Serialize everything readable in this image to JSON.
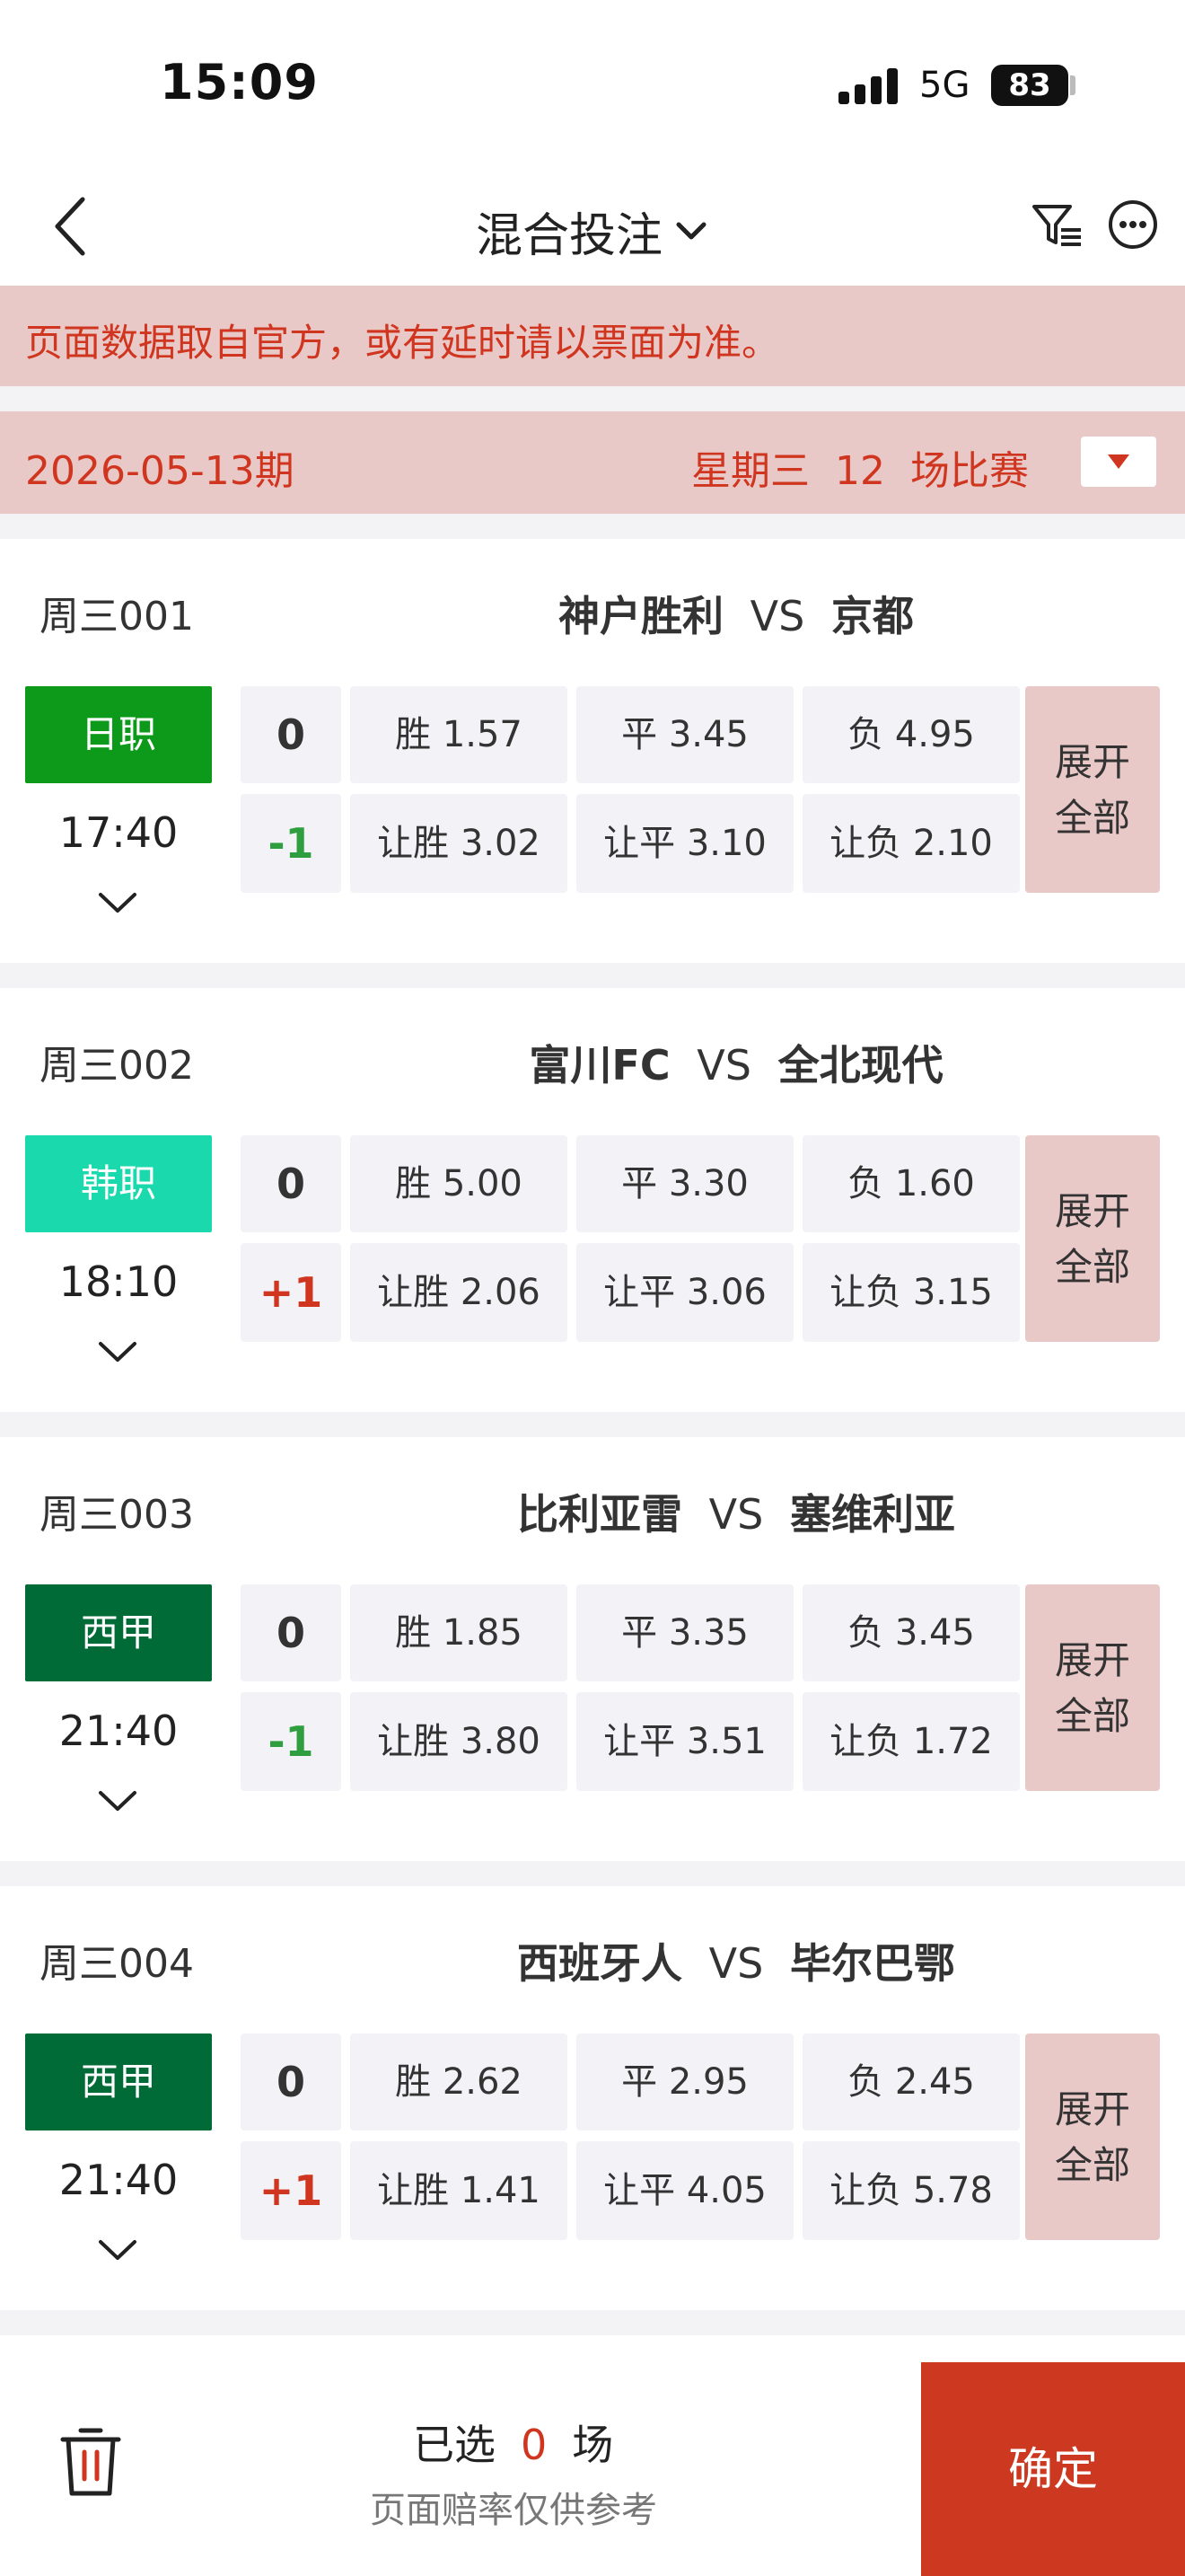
{
  "status_bar": {
    "time": "15:09",
    "network": "5G",
    "battery": "83"
  },
  "nav": {
    "title": "混合投注"
  },
  "notice": "页面数据取自官方，或有延时请以票面为准。",
  "issue": {
    "date": "2026-05-13期",
    "weekday": "星期三",
    "count": "12",
    "count_suffix": "场比赛"
  },
  "matches": [
    {
      "code": "周三001",
      "home": "神户胜利",
      "vs": "VS",
      "away": "京都",
      "league": "日职",
      "league_color": "#0d9a1a",
      "time": "17:40",
      "handicap_zero": "0",
      "handicap": "-1",
      "handicap_sign": "neg",
      "win": "胜 1.57",
      "draw": "平 3.45",
      "lose": "负 4.95",
      "hwin": "让胜 3.02",
      "hdraw": "让平 3.10",
      "hlose": "让负 2.10",
      "expand1": "展开",
      "expand2": "全部"
    },
    {
      "code": "周三002",
      "home": "富川FC",
      "vs": "VS",
      "away": "全北现代",
      "league": "韩职",
      "league_color": "#19d9ad",
      "time": "18:10",
      "handicap_zero": "0",
      "handicap": "+1",
      "handicap_sign": "pos",
      "win": "胜 5.00",
      "draw": "平 3.30",
      "lose": "负 1.60",
      "hwin": "让胜 2.06",
      "hdraw": "让平 3.06",
      "hlose": "让负 3.15",
      "expand1": "展开",
      "expand2": "全部"
    },
    {
      "code": "周三003",
      "home": "比利亚雷",
      "vs": "VS",
      "away": "塞维利亚",
      "league": "西甲",
      "league_color": "#006b37",
      "time": "21:40",
      "handicap_zero": "0",
      "handicap": "-1",
      "handicap_sign": "neg",
      "win": "胜 1.85",
      "draw": "平 3.35",
      "lose": "负 3.45",
      "hwin": "让胜 3.80",
      "hdraw": "让平 3.51",
      "hlose": "让负 1.72",
      "expand1": "展开",
      "expand2": "全部"
    },
    {
      "code": "周三004",
      "home": "西班牙人",
      "vs": "VS",
      "away": "毕尔巴鄂",
      "league": "西甲",
      "league_color": "#006b37",
      "time": "21:40",
      "handicap_zero": "0",
      "handicap": "+1",
      "handicap_sign": "pos",
      "win": "胜 2.62",
      "draw": "平 2.95",
      "lose": "负 2.45",
      "hwin": "让胜 1.41",
      "hdraw": "让平 4.05",
      "hlose": "让负 5.78",
      "expand1": "展开",
      "expand2": "全部"
    }
  ],
  "bottom": {
    "selected_prefix": "已选",
    "selected_count": "0",
    "selected_suffix": "场",
    "note": "页面赔率仅供参考",
    "confirm": "确定"
  },
  "colors": {
    "accent": "#d0361f",
    "notice_bg": "#e9c9c7",
    "confirm_bg": "#cc3820",
    "neg": "#2e9e3e",
    "pos": "#d0361f"
  }
}
